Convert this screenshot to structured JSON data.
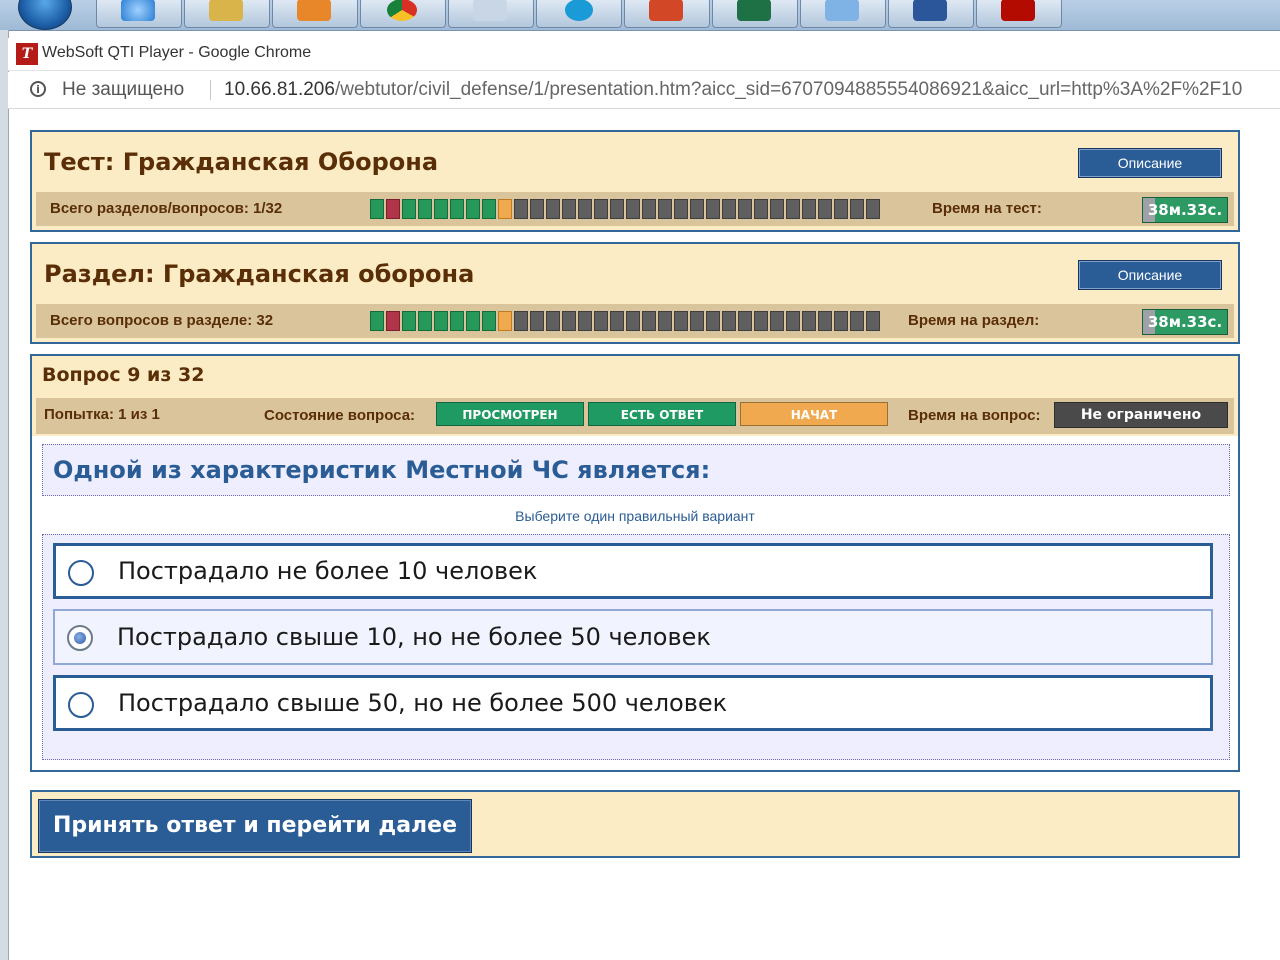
{
  "window": {
    "title": "WebSoft QTI Player - Google Chrome",
    "app_icon_letter": "T"
  },
  "address_bar": {
    "security_label": "Не защищено",
    "url_host": "10.66.81.206",
    "url_path": "/webtutor/civil_defense/1/presentation.htm?aicc_sid=6707094885554086921&aicc_url=http%3A%2F%2F10"
  },
  "test_panel": {
    "title": "Тест: Гражданская Оборона",
    "description_button": "Описание",
    "counter_label": "Всего разделов/вопросов: 1/32",
    "time_label": "Время на тест:",
    "time_value": "38м.33с."
  },
  "section_panel": {
    "title": "Раздел: Гражданская оборона",
    "description_button": "Описание",
    "counter_label": "Всего вопросов в разделе: 32",
    "time_label": "Время на раздел:",
    "time_value": "38м.33с."
  },
  "progress": {
    "total": 32,
    "states": [
      "green",
      "red",
      "green",
      "green",
      "green",
      "green",
      "green",
      "green",
      "current",
      "gray",
      "gray",
      "gray",
      "gray",
      "gray",
      "gray",
      "gray",
      "gray",
      "gray",
      "gray",
      "gray",
      "gray",
      "gray",
      "gray",
      "gray",
      "gray",
      "gray",
      "gray",
      "gray",
      "gray",
      "gray",
      "gray",
      "gray"
    ],
    "colors": {
      "green": "#25985a",
      "red": "#b0354a",
      "current": "#f0a94e",
      "gray": "#5f5f5f"
    }
  },
  "question_header": {
    "title": "Вопрос 9 из 32",
    "attempt": "Попытка: 1 из 1",
    "state_label": "Состояние вопроса:",
    "badges": [
      {
        "label": "ПРОСМОТРЕН",
        "color": "#1f9a63"
      },
      {
        "label": "ЕСТЬ ОТВЕТ",
        "color": "#1f9a63"
      },
      {
        "label": "НАЧАТ",
        "color": "#f0a94e"
      }
    ],
    "time_label": "Время на вопрос:",
    "time_value": "Не ограничено"
  },
  "question": {
    "text": "Одной из характеристик Местной ЧС является:",
    "hint": "Выберите один правильный вариант",
    "answers": [
      {
        "label": "Пострадало не более 10 человек",
        "selected": false
      },
      {
        "label": "Пострадало свыше 10, но не более 50 человек",
        "selected": true
      },
      {
        "label": "Пострадало свыше 50, но не более 500 человек",
        "selected": false
      }
    ]
  },
  "submit": {
    "label": "Принять ответ и перейти далее"
  },
  "taskbar": {
    "items": [
      "start-orb",
      "ie-icon",
      "explorer-icon",
      "outlook-icon",
      "chrome-icon",
      "snipping-icon",
      "skype-icon",
      "powerpoint-icon",
      "excel-icon",
      "paint-icon",
      "word-icon",
      "acrobat-icon"
    ]
  }
}
